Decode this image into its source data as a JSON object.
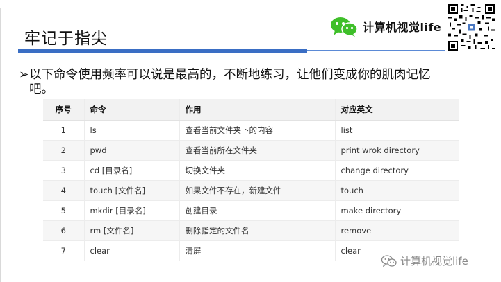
{
  "title": "牢记于指尖",
  "brand": {
    "name": "计算机视觉life",
    "icon": "wechat-icon"
  },
  "bullet": {
    "marker": "➢",
    "text": "以下命令使用频率可以说是最高的，不断地练习，让他们变成你的肌肉记忆吧。"
  },
  "table": {
    "headers": [
      "序号",
      "命令",
      "作用",
      "对应英文"
    ],
    "rows": [
      [
        "1",
        "ls",
        "查看当前文件夹下的内容",
        "list"
      ],
      [
        "2",
        "pwd",
        "查看当前所在文件夹",
        "print wrok directory"
      ],
      [
        "3",
        "cd [目录名]",
        "切换文件夹",
        "change directory"
      ],
      [
        "4",
        "touch [文件名]",
        "如果文件不存在，新建文件",
        "touch"
      ],
      [
        "5",
        "mkdir [目录名]",
        "创建目录",
        "make directory"
      ],
      [
        "6",
        "rm [文件名]",
        "删除指定的文件名",
        "remove"
      ],
      [
        "7",
        "clear",
        "清屏",
        "clear"
      ]
    ]
  },
  "watermark": {
    "text": "计算机视觉life",
    "icon": "wechat-outline-icon"
  },
  "colors": {
    "accent_blue": "#3a6ec4",
    "wechat_green": "#3fbf2a"
  }
}
